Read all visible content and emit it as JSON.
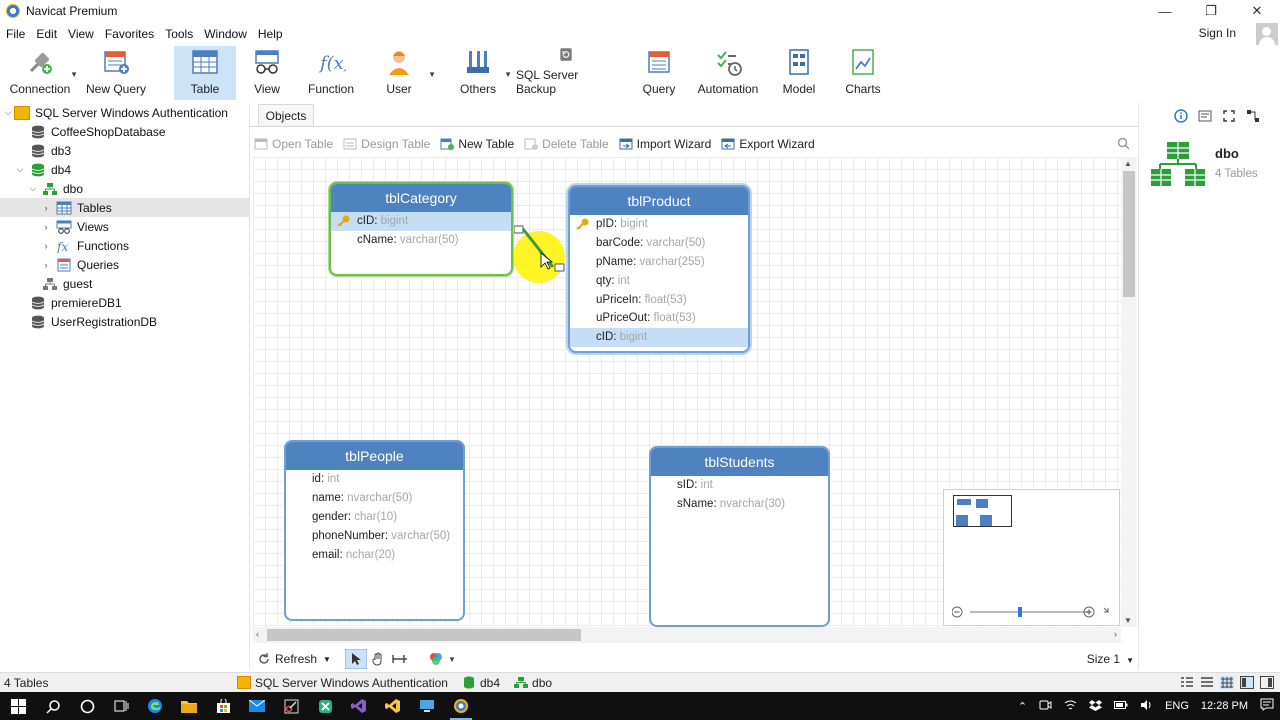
{
  "window": {
    "title": "Navicat Premium",
    "minimize_glyph": "—",
    "restore_glyph": "❐",
    "close_glyph": "✕"
  },
  "menu": {
    "items": [
      "File",
      "Edit",
      "View",
      "Favorites",
      "Tools",
      "Window",
      "Help"
    ],
    "sign_in": "Sign In"
  },
  "toolbar": {
    "buttons": [
      {
        "label": "Connection",
        "icon": "connection-plug-icon"
      },
      {
        "label": "New Query",
        "icon": "new-query-icon"
      },
      {
        "label": "Table",
        "icon": "table-icon",
        "active": true
      },
      {
        "label": "View",
        "icon": "view-glasses-icon"
      },
      {
        "label": "Function",
        "icon": "function-fx-icon"
      },
      {
        "label": "User",
        "icon": "user-icon"
      },
      {
        "label": "Others",
        "icon": "others-tools-icon"
      },
      {
        "label": "SQL Server Backup",
        "icon": "backup-icon"
      },
      {
        "label": "Query",
        "icon": "query-icon"
      },
      {
        "label": "Automation",
        "icon": "automation-icon"
      },
      {
        "label": "Model",
        "icon": "model-icon"
      },
      {
        "label": "Charts",
        "icon": "charts-icon"
      }
    ]
  },
  "tree": {
    "items": [
      {
        "label": "SQL Server Windows Authentication",
        "level": 0,
        "expanded": true,
        "icon": "server-icon"
      },
      {
        "label": "CoffeeShopDatabase",
        "level": 1,
        "icon": "database-icon"
      },
      {
        "label": "db3",
        "level": 1,
        "icon": "database-icon"
      },
      {
        "label": "db4",
        "level": 1,
        "expanded": true,
        "icon": "database-open-icon"
      },
      {
        "label": "dbo",
        "level": 2,
        "expanded": true,
        "icon": "schema-icon"
      },
      {
        "label": "Tables",
        "level": 3,
        "selected": true,
        "icon": "table-icon"
      },
      {
        "label": "Views",
        "level": 3,
        "icon": "view-icon"
      },
      {
        "label": "Functions",
        "level": 3,
        "icon": "function-icon"
      },
      {
        "label": "Queries",
        "level": 3,
        "icon": "query-icon"
      },
      {
        "label": "guest",
        "level": 2,
        "icon": "schema-icon"
      },
      {
        "label": "premiereDB1",
        "level": 1,
        "icon": "database-icon"
      },
      {
        "label": "UserRegistrationDB",
        "level": 1,
        "icon": "database-icon"
      }
    ]
  },
  "objects": {
    "tab_label": "Objects",
    "actions": [
      {
        "label": "Open Table",
        "enabled": false
      },
      {
        "label": "Design Table",
        "enabled": false
      },
      {
        "label": "New Table",
        "enabled": true
      },
      {
        "label": "Delete Table",
        "enabled": false
      },
      {
        "label": "Import Wizard",
        "enabled": true
      },
      {
        "label": "Export Wizard",
        "enabled": true
      }
    ]
  },
  "diagram": {
    "tables": [
      {
        "name": "tblCategory",
        "selection": "green",
        "fields": [
          {
            "name": "cID",
            "type": "bigint",
            "key": true,
            "highlight": true
          },
          {
            "name": "cName",
            "type": "varchar(50)"
          }
        ]
      },
      {
        "name": "tblProduct",
        "selection": "blue",
        "fields": [
          {
            "name": "pID",
            "type": "bigint",
            "key": true
          },
          {
            "name": "barCode",
            "type": "varchar(50)"
          },
          {
            "name": "pName",
            "type": "varchar(255)"
          },
          {
            "name": "qty",
            "type": "int"
          },
          {
            "name": "uPriceIn",
            "type": "float(53)"
          },
          {
            "name": "uPriceOut",
            "type": "float(53)"
          },
          {
            "name": "cID",
            "type": "bigint",
            "highlight": true
          }
        ]
      },
      {
        "name": "tblPeople",
        "fields": [
          {
            "name": "id",
            "type": "int"
          },
          {
            "name": "name",
            "type": "nvarchar(50)"
          },
          {
            "name": "gender",
            "type": "char(10)"
          },
          {
            "name": "phoneNumber",
            "type": "varchar(50)"
          },
          {
            "name": "email",
            "type": "nchar(20)"
          }
        ]
      },
      {
        "name": "tblStudents",
        "fields": [
          {
            "name": "sID",
            "type": "int"
          },
          {
            "name": "sName",
            "type": "nvarchar(30)"
          }
        ]
      }
    ]
  },
  "info_panel": {
    "name": "dbo",
    "count": "4 Tables"
  },
  "canvas_bar": {
    "refresh_label": "Refresh",
    "size_label": "Size 1"
  },
  "status": {
    "count": "4 Tables",
    "connection": "SQL Server Windows Authentication",
    "database": "db4",
    "schema": "dbo"
  },
  "taskbar": {
    "language": "ENG",
    "time": "12:28 PM"
  },
  "colors": {
    "table_header": "#4f82c0",
    "selected_green": "#6cc04a",
    "highlight_row": "#c6ddf6",
    "relation_line": "#3c9a3c",
    "cursor_highlight": "#fff200"
  }
}
